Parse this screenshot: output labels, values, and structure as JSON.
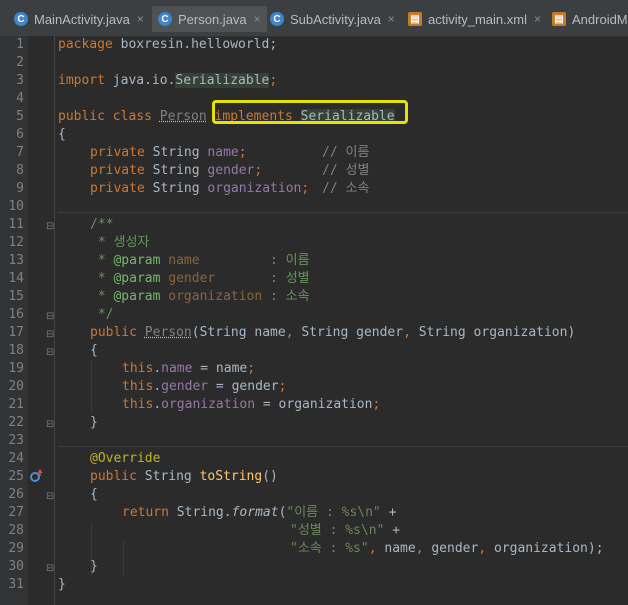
{
  "tabs": [
    {
      "label": "MainActivity.java",
      "icon": "java-class-icon",
      "active": false
    },
    {
      "label": "Person.java",
      "icon": "java-class-icon",
      "active": true
    },
    {
      "label": "SubActivity.java",
      "icon": "java-class-icon",
      "active": false
    },
    {
      "label": "activity_main.xml",
      "icon": "xml-layout-icon",
      "active": false
    },
    {
      "label": "AndroidMa",
      "icon": "java-class-icon",
      "active": false
    }
  ],
  "tab_close": "×",
  "line_numbers": [
    "1",
    "2",
    "3",
    "4",
    "5",
    "6",
    "7",
    "8",
    "9",
    "10",
    "11",
    "12",
    "13",
    "14",
    "15",
    "16",
    "17",
    "18",
    "19",
    "20",
    "21",
    "22",
    "23",
    "24",
    "25",
    "26",
    "27",
    "28",
    "29",
    "30",
    "31"
  ],
  "code": {
    "l1_kw": "package",
    "l1_rest": " boxresin.helloworld;",
    "l3_kw": "import",
    "l3_pkg": " java.io.",
    "l3_cls": "Serializable",
    "l3_end": ";",
    "l5_kw1": "public class",
    "l5_name": "Person",
    "l5_kw2": "implements",
    "l5_iface": "Serializable",
    "brace_open": "{",
    "brace_close": "}",
    "l7": {
      "kw": "private",
      "type": " String ",
      "fld": "name",
      "end": ";",
      "cmt": "// 이름"
    },
    "l8": {
      "kw": "private",
      "type": " String ",
      "fld": "gender",
      "end": ";",
      "cmt": "// 성별"
    },
    "l9": {
      "kw": "private",
      "type": " String ",
      "fld": "organization",
      "end": ";",
      "cmt": "// 소속"
    },
    "l11": "/**",
    "l12": " * 생성자",
    "l13": {
      "star": " * ",
      "tag": "@param",
      "name": " name",
      "desc": "         : 이름"
    },
    "l14": {
      "star": " * ",
      "tag": "@param",
      "name": " gender",
      "desc": "       : 성별"
    },
    "l15": {
      "star": " * ",
      "tag": "@param",
      "name": " organization",
      "desc": " : 소속"
    },
    "l16": " */",
    "l17": {
      "kw": "public",
      "name": "Person",
      "p1": "(String name",
      "c1": ",",
      "p2": " String gender",
      "c2": ",",
      "p3": " String organization)"
    },
    "assign": [
      {
        "this": "this",
        "dot": ".",
        "fld": "name",
        "rest": " = name",
        "end": ";"
      },
      {
        "this": "this",
        "dot": ".",
        "fld": "gender",
        "rest": " = gender",
        "end": ";"
      },
      {
        "this": "this",
        "dot": ".",
        "fld": "organization",
        "rest": " = organization",
        "end": ";"
      }
    ],
    "l24": "@Override",
    "l25": {
      "kw": "public",
      "type": " String ",
      "mth": "toString",
      "rest": "()"
    },
    "l27": {
      "kw": "return",
      "cls": " String.",
      "mth": "format",
      "open": "(",
      "str": "\"이름 : %s\\n\"",
      "plus": " +"
    },
    "l28": {
      "str": "\"성별 : %s\\n\"",
      "plus": " +"
    },
    "l29": {
      "str": "\"소속 : %s\"",
      "c": ",",
      "a": " name",
      "c2": ",",
      "b": " gender",
      "c3": ",",
      "d": " organization);"
    }
  },
  "colors": {
    "background": "#2b2b2b",
    "keyword": "#cc7832",
    "field": "#9876aa",
    "string": "#6a8759",
    "comment": "#808080",
    "highlight_box": "#e4e400"
  }
}
